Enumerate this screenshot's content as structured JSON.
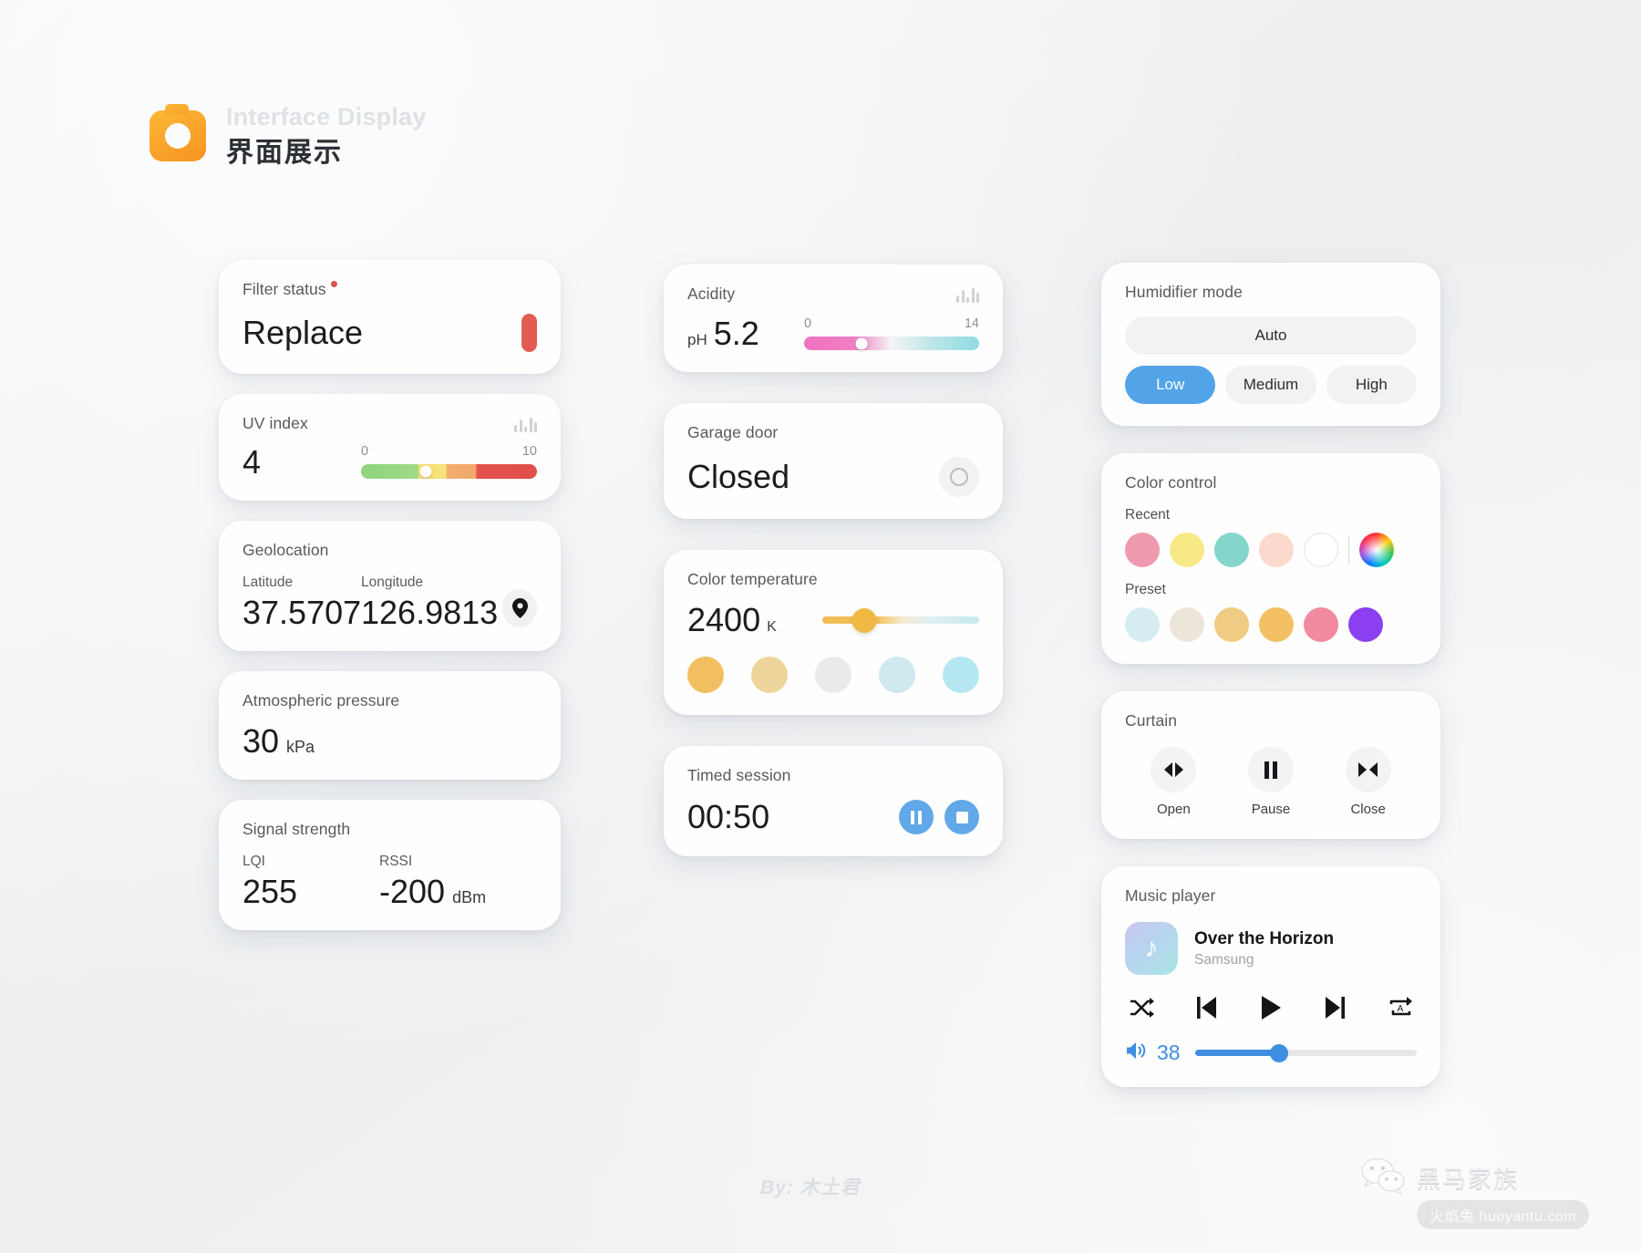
{
  "header": {
    "title_en": "Interface Display",
    "title_cn": "界面展示",
    "logo_icon": "camera-icon"
  },
  "columns": {
    "left": {
      "filter_status": {
        "label": "Filter status",
        "value": "Replace",
        "alert_dot": true,
        "indicator_color": "#e25c55"
      },
      "uv_index": {
        "label": "UV index",
        "value": "4",
        "scale_min": "0",
        "scale_max": "10",
        "knob_percent": 37,
        "chart_icon": "bar-chart-icon"
      },
      "geolocation": {
        "label": "Geolocation",
        "latitude_label": "Latitude",
        "latitude_value": "37.5707",
        "longitude_label": "Longitude",
        "longitude_value": "126.9813",
        "pin_icon": "map-pin-icon"
      },
      "atmospheric_pressure": {
        "label": "Atmospheric pressure",
        "value": "30",
        "unit": "kPa"
      },
      "signal_strength": {
        "label": "Signal strength",
        "lqi_label": "LQI",
        "lqi_value": "255",
        "rssi_label": "RSSI",
        "rssi_value": "-200",
        "rssi_unit": "dBm"
      }
    },
    "middle": {
      "acidity": {
        "label": "Acidity",
        "prefix": "pH",
        "value": "5.2",
        "scale_min": "0",
        "scale_max": "14",
        "knob_percent": 33,
        "chart_icon": "bar-chart-icon"
      },
      "garage_door": {
        "label": "Garage door",
        "value": "Closed",
        "toggle_icon": "circle-outline-icon"
      },
      "color_temperature": {
        "label": "Color temperature",
        "value": "2400",
        "unit": "K",
        "knob_percent": 27,
        "swatches": [
          "#f2bf60",
          "#edd49b",
          "#e9eaeb",
          "#cfe9ee",
          "#b5e8f0"
        ]
      },
      "timed_session": {
        "label": "Timed session",
        "value": "00:50",
        "pause_icon": "pause-icon",
        "stop_icon": "stop-icon",
        "button_color": "#61a8e8"
      }
    },
    "right": {
      "humidifier_mode": {
        "label": "Humidifier mode",
        "auto_label": "Auto",
        "options": [
          "Low",
          "Medium",
          "High"
        ],
        "selected": "Low",
        "accent": "#53a3e8"
      },
      "color_control": {
        "label": "Color control",
        "recent_label": "Recent",
        "recent_colors": [
          "#f09ab0",
          "#f8e987",
          "#84d6cb",
          "#fbd9cc",
          "#ffffff"
        ],
        "wheel_icon": "color-wheel-icon",
        "preset_label": "Preset",
        "preset_colors": [
          "#d4ecf2",
          "#ece6da",
          "#f0cb83",
          "#f2c062",
          "#f1899f",
          "#8b3ff0"
        ]
      },
      "curtain": {
        "label": "Curtain",
        "buttons": [
          {
            "label": "Open",
            "icon": "open-arrows-icon"
          },
          {
            "label": "Pause",
            "icon": "pause-icon"
          },
          {
            "label": "Close",
            "icon": "close-arrows-icon"
          }
        ]
      },
      "music_player": {
        "label": "Music player",
        "track_title": "Over the Horizon",
        "artist": "Samsung",
        "album_icon": "music-note-icon",
        "controls": [
          {
            "icon": "shuffle-icon"
          },
          {
            "icon": "previous-icon"
          },
          {
            "icon": "play-icon"
          },
          {
            "icon": "next-icon"
          },
          {
            "icon": "repeat-a-icon"
          }
        ],
        "volume_icon": "speaker-icon",
        "volume_value": "38",
        "volume_percent": 38,
        "accent": "#3f8ee0"
      }
    }
  },
  "footer": {
    "byline": "By: 木土君"
  },
  "watermark": {
    "icon": "wechat-icon",
    "name": "黑马家族",
    "site": "火焰兔 huoyantu.com"
  }
}
